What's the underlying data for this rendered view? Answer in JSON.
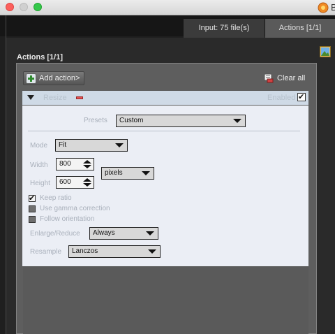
{
  "window": {
    "app_title": "B"
  },
  "tabs": [
    {
      "label": "Input: 75 file(s)"
    },
    {
      "label": "Actions [1/1]"
    }
  ],
  "actions_panel": {
    "title": "Actions [1/1]",
    "add_action_label": "Add action>",
    "clear_all_label": "Clear all",
    "action": {
      "name": "Resize",
      "enabled_label": "Enabled",
      "enabled": true,
      "presets_label": "Presets",
      "presets_value": "Custom",
      "mode_label": "Mode",
      "mode_value": "Fit",
      "width_label": "Width",
      "width_value": "800",
      "height_label": "Height",
      "height_value": "600",
      "unit_value": "pixels",
      "keep_ratio_label": "Keep ratio",
      "keep_ratio": true,
      "gamma_label": "Use gamma correction",
      "gamma": false,
      "orientation_label": "Follow orientation",
      "orientation": false,
      "enlarge_label": "Enlarge/Reduce",
      "enlarge_value": "Always",
      "resample_label": "Resample",
      "resample_value": "Lanczos"
    }
  },
  "check_glyph": "✔",
  "icons": {
    "window": [
      "close-light",
      "minimize-light",
      "zoom-light"
    ],
    "app": "app-logo-icon",
    "side": "image-icon",
    "add": "plus-icon",
    "clear": "eraser-icon",
    "collapse": "triangle-down-icon",
    "remove": "minus-icon"
  },
  "colors": {
    "header_bg": "#cfdae6",
    "body_bg": "#ebeef5",
    "panel_bg": "#5e5e5e",
    "tab_active": "#5a5a5a",
    "tab_inactive": "#3b3b3b"
  }
}
